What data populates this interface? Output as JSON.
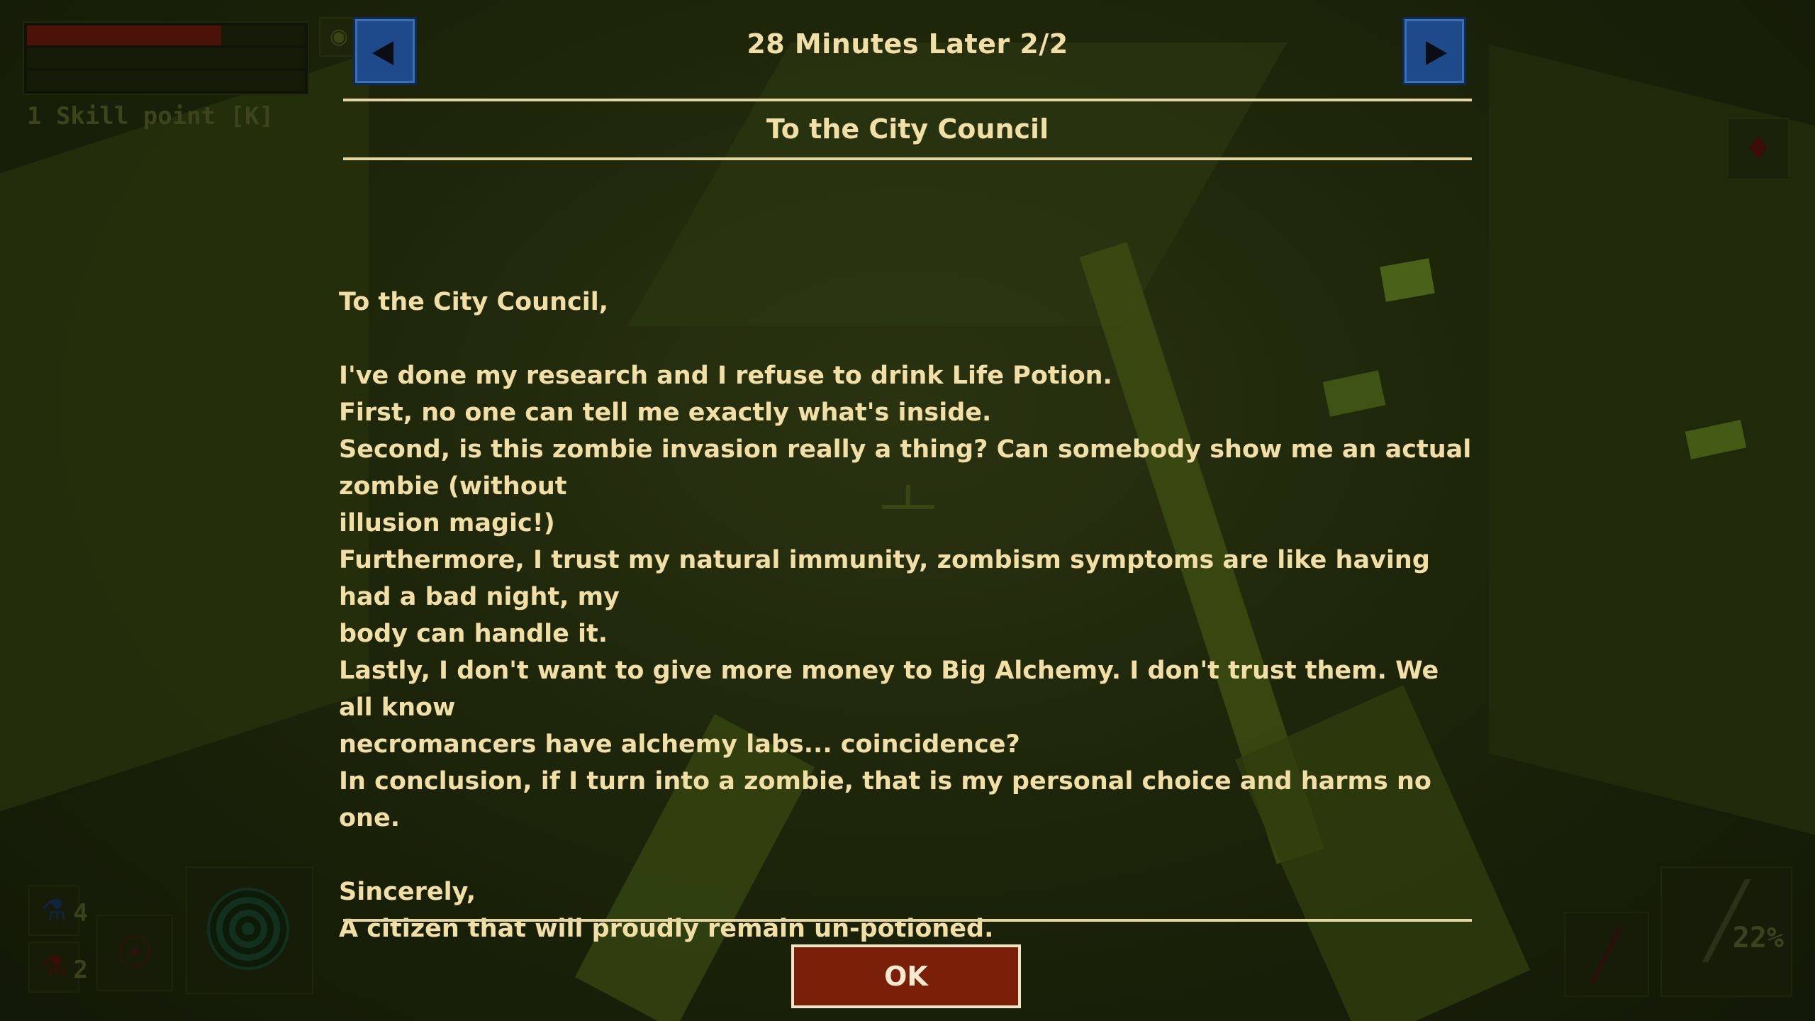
{
  "hud": {
    "bars": {
      "health": 0.7,
      "stamina": 0.0,
      "mana": 0.0
    },
    "skill_points": "1 Skill point [K]",
    "potion_blue_count": "4",
    "potion_red_count": "2",
    "weapon_durability": "22%"
  },
  "dialog": {
    "header": "28 Minutes Later 2/2",
    "subtitle": "To the City Council",
    "letter_lines": [
      "To the City Council,",
      "",
      "I've done my research and I refuse to drink Life Potion.",
      "First, no one can tell me exactly what's inside.",
      "Second, is this zombie invasion really a thing? Can somebody show me an actual zombie (without",
      "illusion magic!)",
      "Furthermore, I trust my natural immunity, zombism symptoms are like having had a bad night, my",
      "body can handle it.",
      "Lastly, I don't want to give more money to Big Alchemy. I don't trust them. We all know",
      "necromancers have alchemy labs... coincidence?",
      "In conclusion, if I turn into a zombie, that is my personal choice and harms no one.",
      "",
      "Sincerely,",
      "A citizen that will proudly remain un-potioned."
    ],
    "ok_label": "OK"
  },
  "colors": {
    "text": "#f2dfa6",
    "nav_button": "#1e4a8c",
    "ok_button": "#7a1f08",
    "rule": "#e5d5a0"
  }
}
